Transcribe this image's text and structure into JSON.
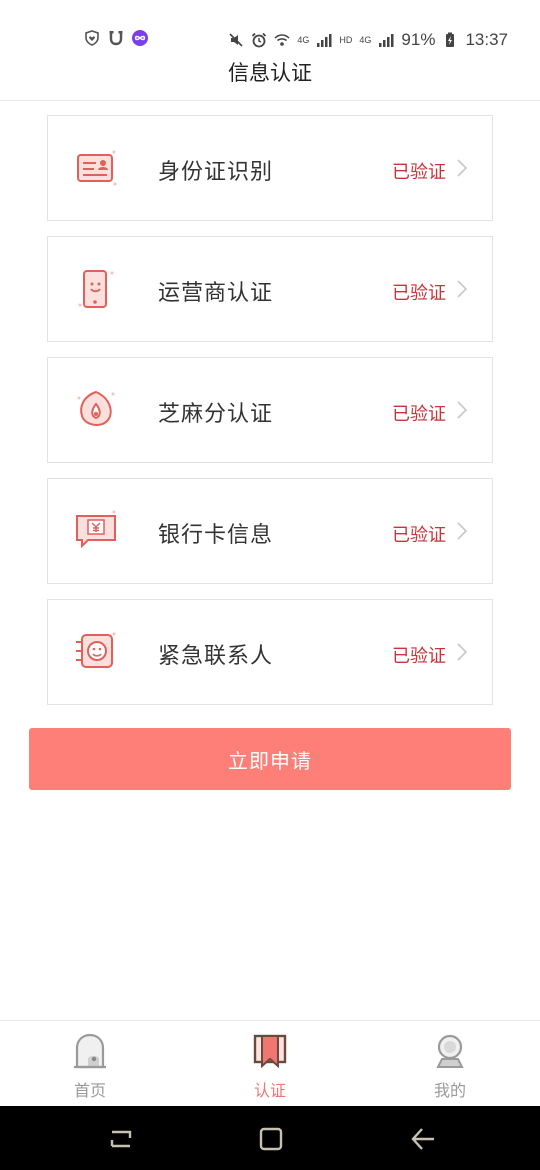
{
  "status_bar": {
    "battery": "91%",
    "time": "13:37",
    "net1": "4G",
    "net2": "HD",
    "net3": "4G",
    "left_icons": [
      "shield-heart-icon",
      "u-app-icon",
      "infinity-app-icon"
    ],
    "right_icons": [
      "mute-icon",
      "alarm-icon",
      "wifi-icon",
      "signal-icon",
      "signal-icon",
      "battery-charging-icon"
    ]
  },
  "header": {
    "title": "信息认证"
  },
  "cards": [
    {
      "label": "身份证识别",
      "status": "已验证",
      "icon": "id-card-icon"
    },
    {
      "label": "运营商认证",
      "status": "已验证",
      "icon": "phone-icon"
    },
    {
      "label": "芝麻分认证",
      "status": "已验证",
      "icon": "sesame-icon"
    },
    {
      "label": "银行卡信息",
      "status": "已验证",
      "icon": "bank-card-icon"
    },
    {
      "label": "紧急联系人",
      "status": "已验证",
      "icon": "contact-face-icon"
    }
  ],
  "apply_button": {
    "label": "立即申请"
  },
  "tabs": [
    {
      "label": "首页",
      "icon": "home-icon",
      "active": false
    },
    {
      "label": "认证",
      "icon": "bookmark-icon",
      "active": true
    },
    {
      "label": "我的",
      "icon": "user-icon",
      "active": false
    }
  ],
  "colors": {
    "accent": "#fd7f77",
    "status_text": "#c8343a",
    "active_tab": "#f0776f",
    "inactive_tab": "#9a9a9a"
  }
}
